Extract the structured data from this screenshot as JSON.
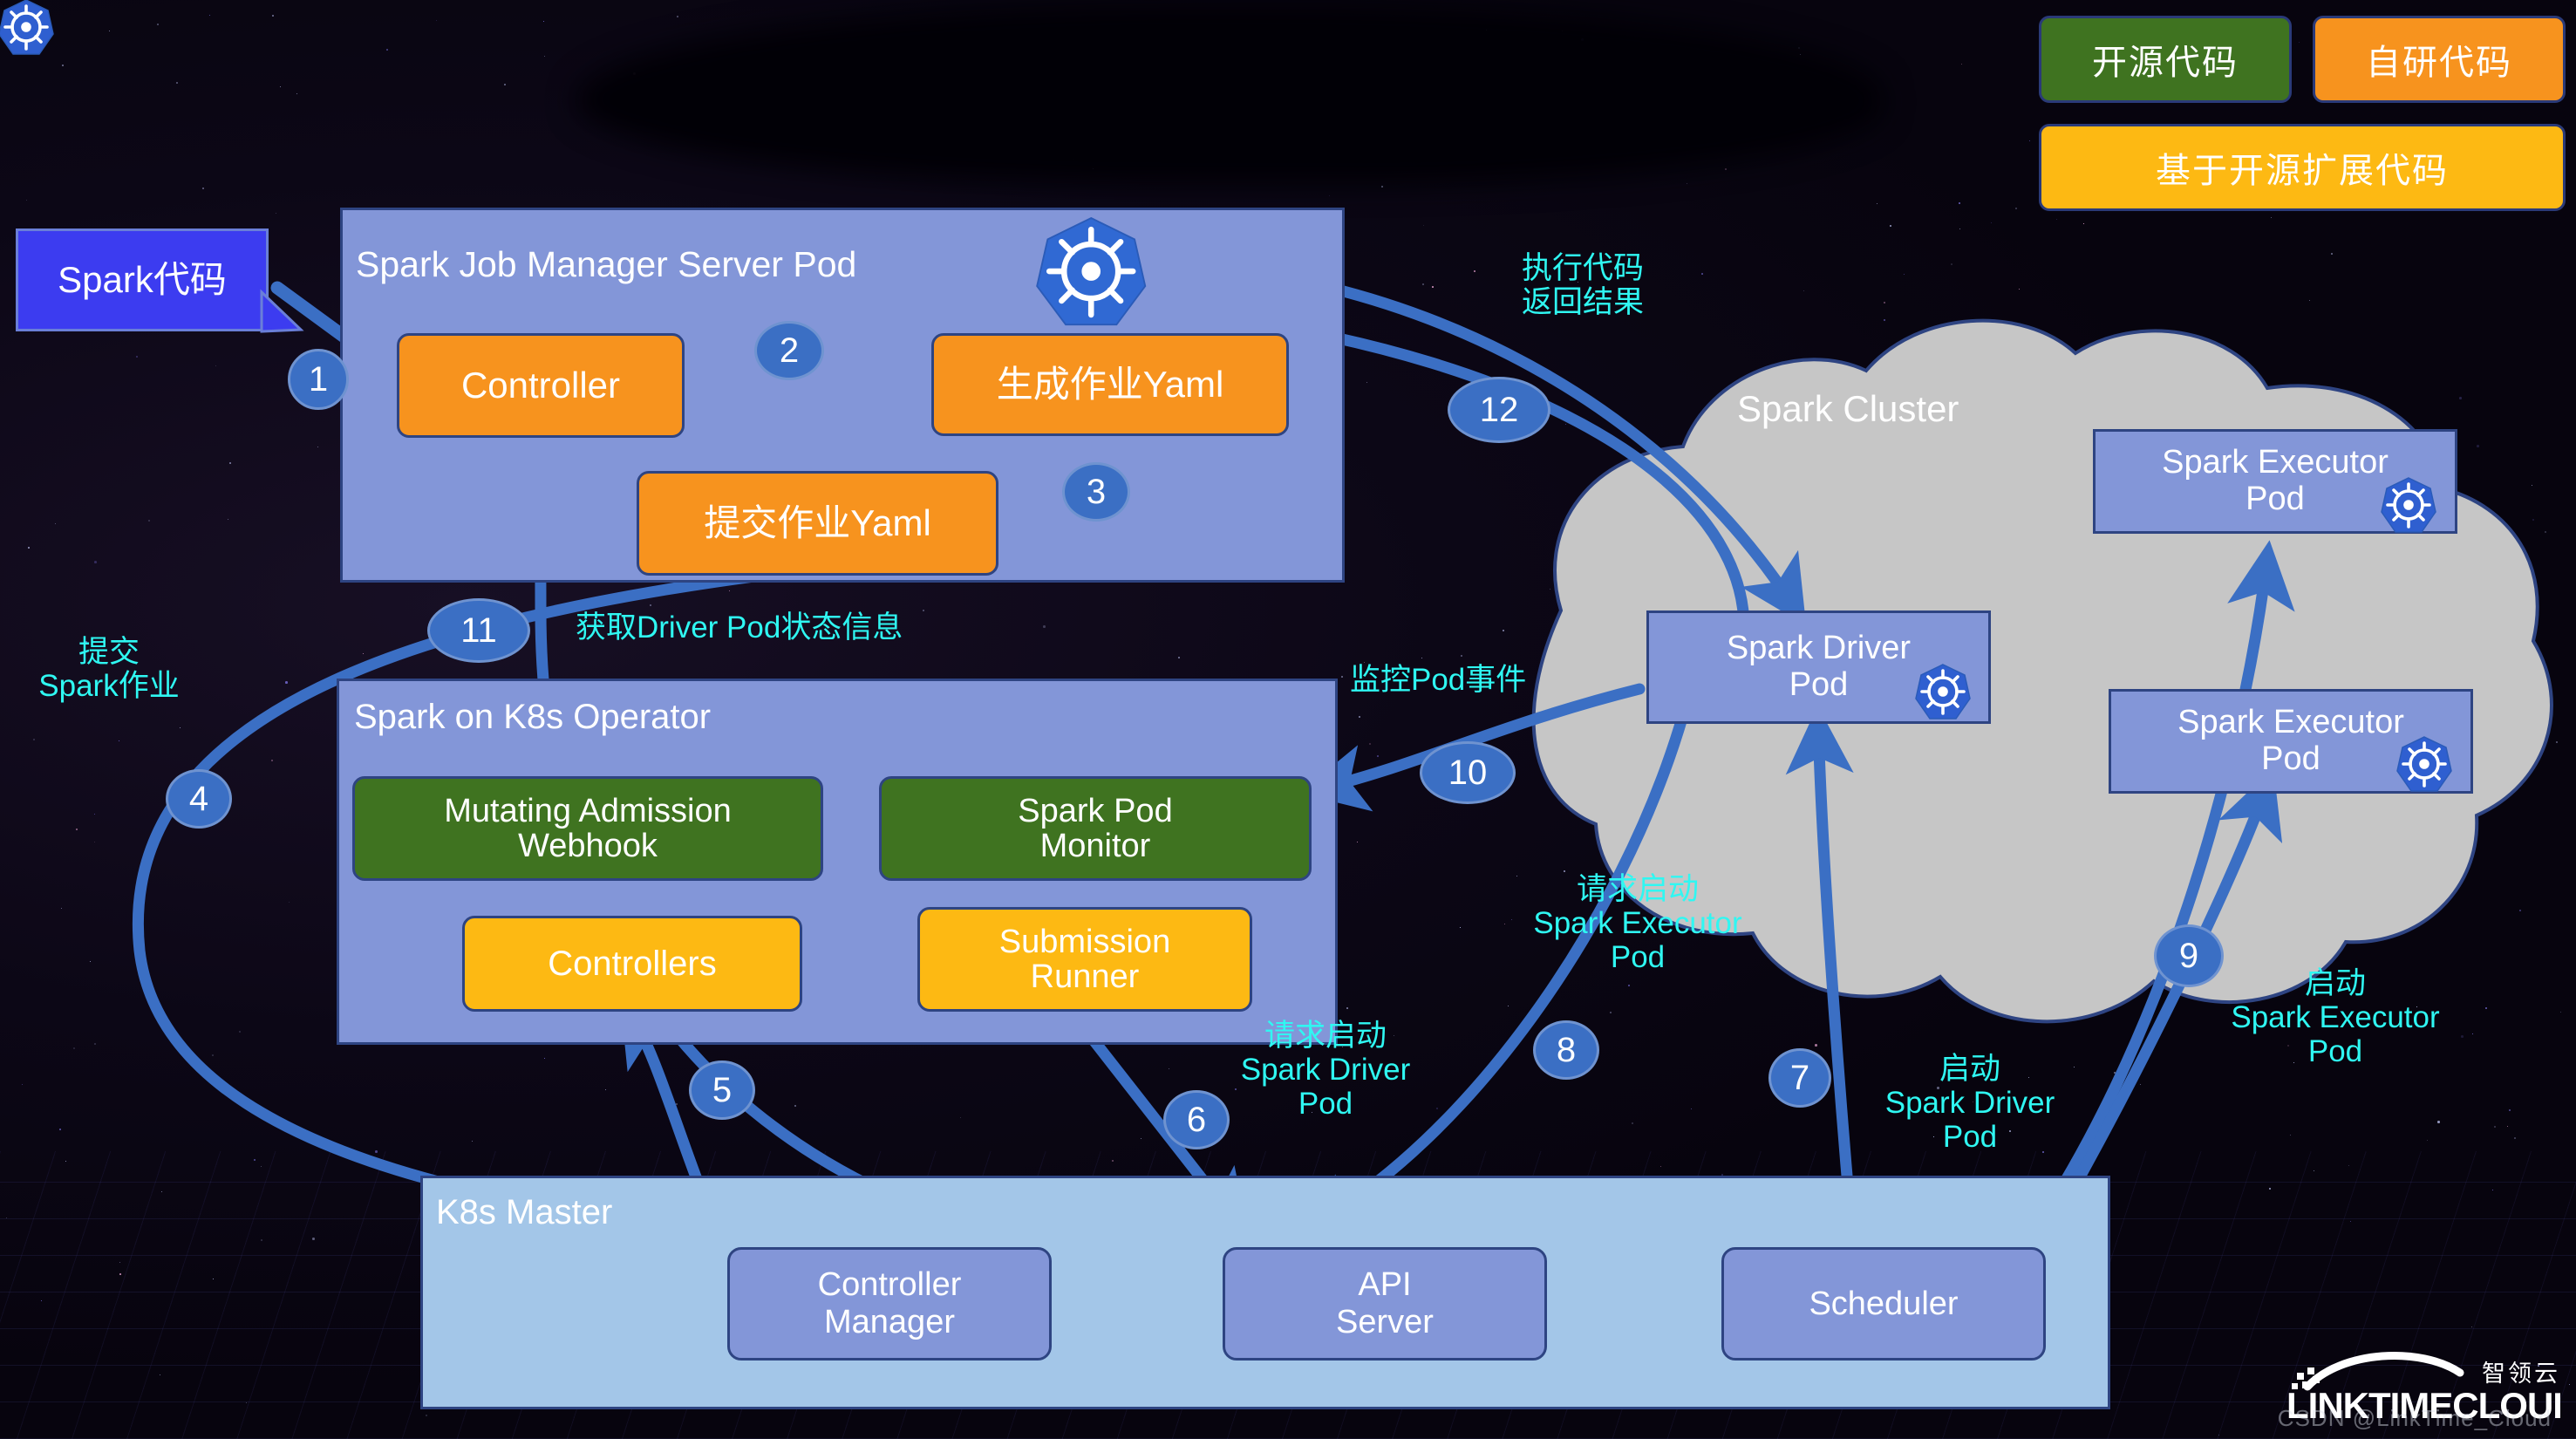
{
  "legend": {
    "items": [
      {
        "label": "开源代码",
        "color": "#3f7320",
        "name": "legend-open-source"
      },
      {
        "label": "自研代码",
        "color": "#f7931e",
        "name": "legend-self-developed"
      },
      {
        "label": "基于开源扩展代码",
        "color": "#fdb913",
        "name": "legend-extended-open-source"
      }
    ]
  },
  "nodes": {
    "spark_code": "Spark代码",
    "job_manager_pod": "Spark Job Manager Server Pod",
    "controller": "Controller",
    "generate_yaml": "生成作业Yaml",
    "submit_yaml": "提交作业Yaml",
    "operator_pod": "Spark on K8s Operator",
    "mutating_admission_webhook": "Mutating Admission\nWebhook",
    "spark_pod_monitor": "Spark Pod\nMonitor",
    "controllers": "Controllers",
    "submission_runner": "Submission\nRunner",
    "k8s_master": "K8s Master",
    "controller_manager": "Controller\nManager",
    "api_server": "API\nServer",
    "scheduler": "Scheduler",
    "spark_cluster": "Spark Cluster",
    "spark_driver_pod": "Spark Driver\nPod",
    "spark_executor_pod_1": "Spark Executor\nPod",
    "spark_executor_pod_2": "Spark Executor\nPod"
  },
  "steps": [
    {
      "num": "1",
      "label": ""
    },
    {
      "num": "2",
      "label": ""
    },
    {
      "num": "3",
      "label": ""
    },
    {
      "num": "4",
      "label": "提交\nSpark作业"
    },
    {
      "num": "5",
      "label": ""
    },
    {
      "num": "6",
      "label": "请求启动\nSpark Driver\nPod"
    },
    {
      "num": "7",
      "label": "启动\nSpark Driver\nPod"
    },
    {
      "num": "8",
      "label": "请求启动\nSpark Executor\nPod"
    },
    {
      "num": "9",
      "label": "启动\nSpark Executor\nPod"
    },
    {
      "num": "10",
      "label": "监控Pod事件"
    },
    {
      "num": "11",
      "label": "获取Driver Pod状态信息"
    },
    {
      "num": "12",
      "label": "执行代码\n返回结果"
    }
  ],
  "watermark": {
    "brand": "LINKTIMECLOUD",
    "brand_cn": "智领云",
    "csdn": "CSDN @LinkTime_Cloud"
  },
  "colors": {
    "open_source": "#3f7320",
    "self_developed": "#f7931e",
    "extended": "#fdb913",
    "pod_container": "#8396d8",
    "k8s_master": "#a3c6e8",
    "cluster_cloud": "#c6c6c6",
    "arrow": "#3b6fc4",
    "annotation": "#2ff7f2"
  }
}
